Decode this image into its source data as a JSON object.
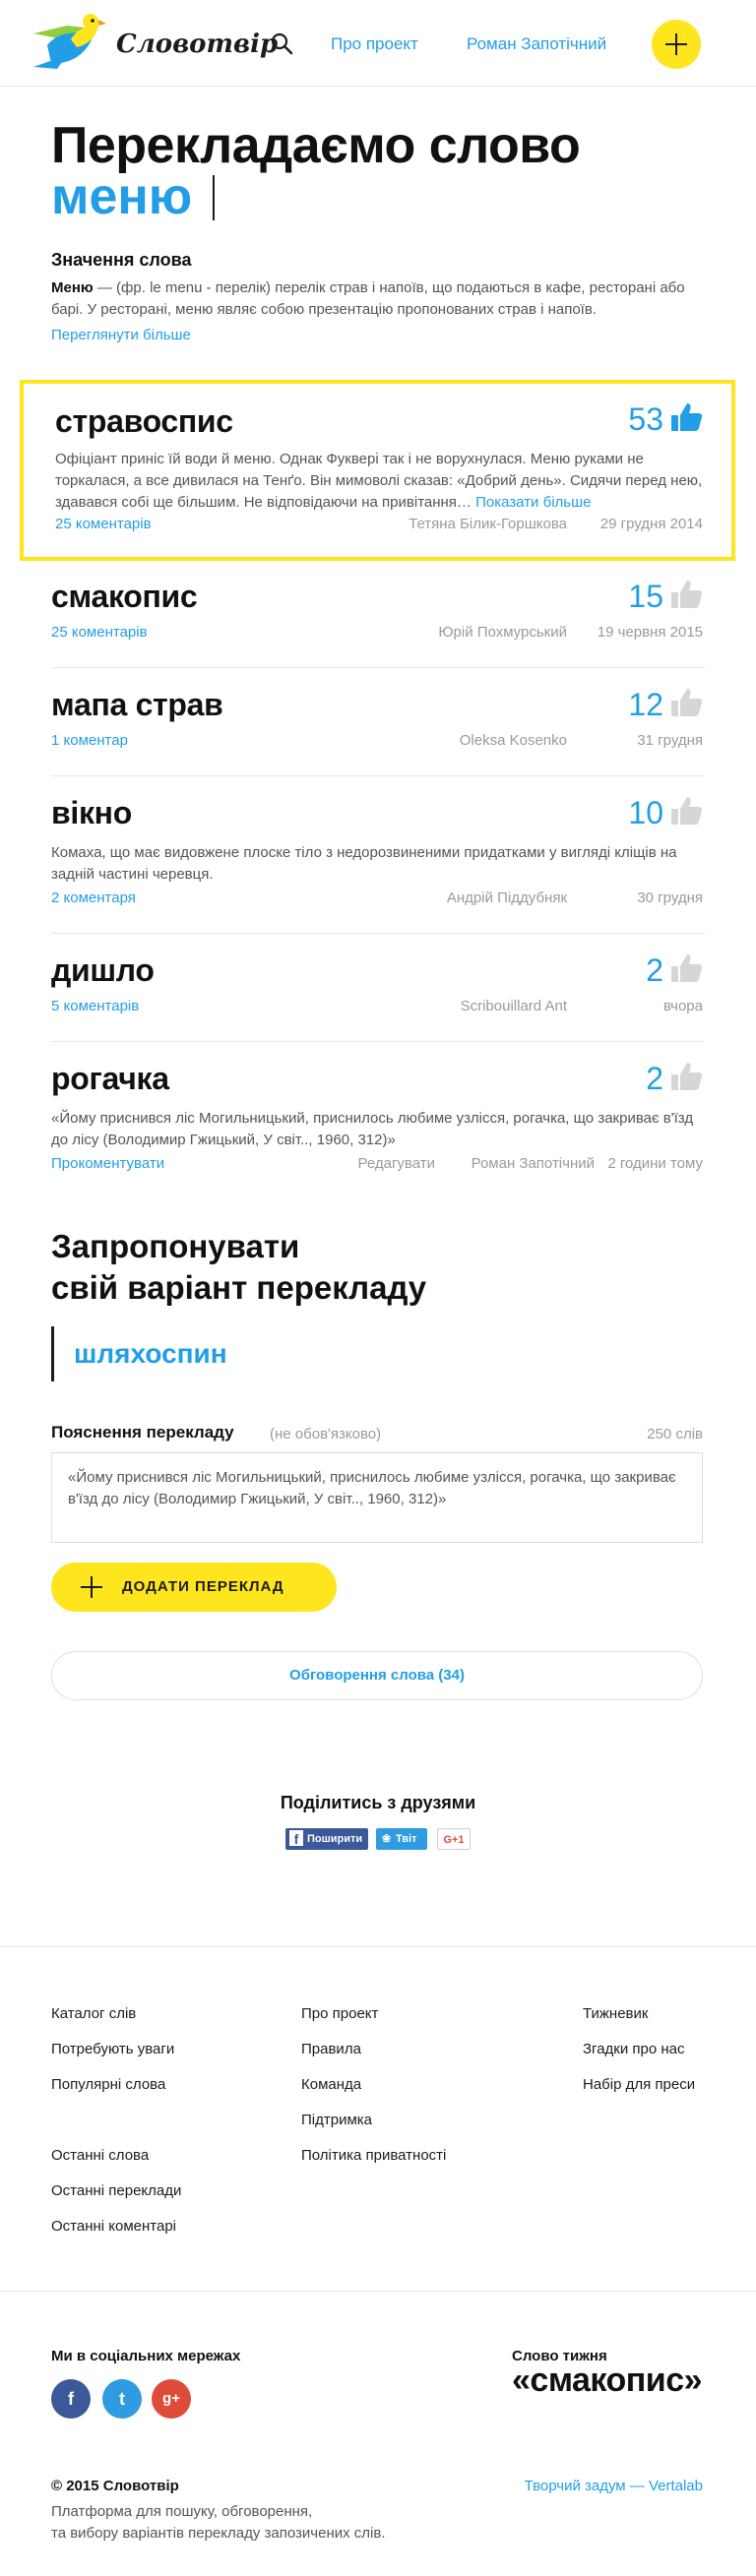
{
  "header": {
    "logo_text": "Словотвір",
    "nav_about": "Про проект",
    "nav_novel": "Роман Запотічний"
  },
  "title": {
    "heading": "Перекладаємо слово",
    "word": "меню"
  },
  "meaning": {
    "heading": "Значення слова",
    "term": "Меню",
    "text": " — (фр. le menu - перелік) перелік страв і напоїв, що подаються в кафе, ресторані або барі. У ресторані, меню являє собою презентацію пропонованих страв і напоїв.",
    "more": "Переглянути більше"
  },
  "cards": [
    {
      "word": "стравоспис",
      "votes": "53",
      "desc": "Офіціант приніс їй води й меню. Однак Фукверi так і не ворухнулася. Меню руками не торкалася, а все дивилася на Тенґо. Він мимоволі сказав: «Добрий день». Сидячи перед нею, здавався собі ще більшим. Не відповідаючи на привітання…",
      "desc_more": "Показати більше",
      "comments": "25 коментарів",
      "author": "Тетяна Білик-Горшкова",
      "date": "29 грудня 2014"
    },
    {
      "word": "смакопис",
      "votes": "15",
      "comments": "25 коментарів",
      "author": "Юрій Похмурський",
      "date": "19 червня 2015"
    },
    {
      "word": "мапа страв",
      "votes": "12",
      "comments": "1 коментар",
      "author": "Oleksa Kosenko",
      "date": "31 грудня"
    },
    {
      "word": "вікно",
      "votes": "10",
      "desc": "Комаха, що має видовжене плоске тіло з недорозвиненими придатками у вигляді кліщів на задній частині черевця.",
      "comments": "2 коментаря",
      "author": "Андрій Піддубняк",
      "date": "30 грудня"
    },
    {
      "word": "дишло",
      "votes": "2",
      "comments": "5 коментарів",
      "author": "Scribouillard Ant",
      "date": "вчора"
    },
    {
      "word": "рогачка",
      "votes": "2",
      "desc": "«Йому приснився ліс Могильницький, приснилось любиме узлісся, рогачка, що закриває в'їзд до лісу (Володимир Гжицький, У світ.., 1960, 312)»",
      "comments": "Прокоментувати",
      "edit": "Редагувати",
      "author": "Роман Запотічний",
      "date": "2 години тому"
    }
  ],
  "suggest": {
    "title_line1": "Запропонувати",
    "title_line2": "свій варіант перекладу",
    "input_value": "шляхоспин",
    "explanation_label": "Пояснення перекладу",
    "explanation_optional": "(не обов'язково)",
    "explanation_count": "250 слів",
    "explanation_value": "«Йому приснився ліс Могильницький, приснилось любиме узлісся, рогачка, що закриває в'їзд до лісу (Володимир Гжицький, У світ.., 1960, 312)»",
    "add_button": "ДОДАТИ ПЕРЕКЛАД",
    "discussion_button": "Обговорення слова (34)"
  },
  "share": {
    "title": "Поділитись з друзями",
    "facebook": "Поширити",
    "twitter": "Твіт",
    "gplus": "G+1"
  },
  "footer": {
    "col1": [
      "Каталог слів",
      "Потребують уваги",
      "Популярні слова",
      "Останні слова",
      "Останні переклади",
      "Останні коментарі"
    ],
    "col2": [
      "Про проект",
      "Правила",
      "Команда",
      "Підтримка",
      "Політика приватності"
    ],
    "col3": [
      "Тижневик",
      "Згадки про нас",
      "Набір для преси"
    ],
    "social_title": "Ми в соціальних мережах",
    "word_of_week_label": "Слово тижня",
    "word_of_week": "«смакопис»",
    "copyright": "© 2015 Словотвір",
    "platform_line1": "Платформа для пошуку, обговорення,",
    "platform_line2": "та вибору варіантів перекладу запозичених слів.",
    "credit": "Творчий задум — Vertalab"
  },
  "colors": {
    "accent": "#229ee6",
    "yellow": "#ffe51d",
    "facebook": "#3b5998",
    "twitter": "#2f9be0",
    "gplus": "#dd4b39"
  }
}
